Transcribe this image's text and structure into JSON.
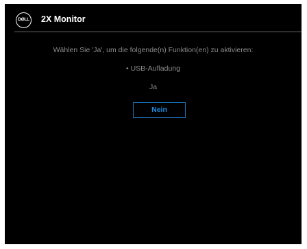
{
  "header": {
    "logo_text": "DØLL",
    "title": "2X Monitor"
  },
  "dialog": {
    "message": "Wählen Sie 'Ja', um die folgende(n) Funktion(en) zu aktivieren:",
    "feature": "• USB-Aufladung",
    "yes_label": "Ja",
    "no_label": "Nein"
  },
  "colors": {
    "background": "#000000",
    "text_muted": "#8c8c8c",
    "accent": "#1b8fe0",
    "divider": "#6e6e6e"
  }
}
